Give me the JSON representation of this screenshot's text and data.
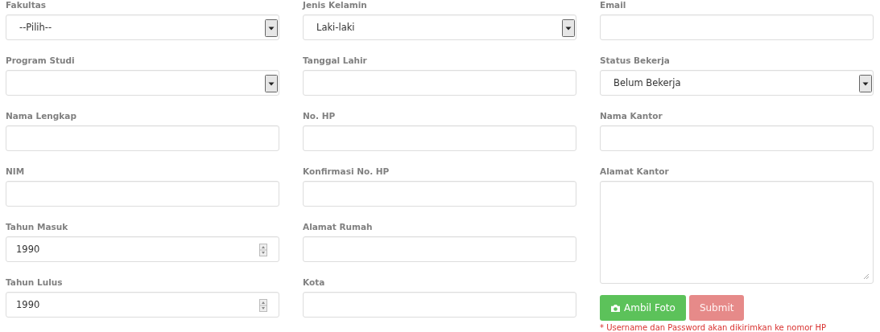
{
  "columns": [
    {
      "fields": [
        {
          "label": "Fakultas",
          "kind": "select",
          "value": "--Pilih--"
        },
        {
          "label": "Program Studi",
          "kind": "select"
        },
        {
          "label": "Nama Lengkap",
          "kind": "text"
        },
        {
          "label": "NIM",
          "kind": "text"
        },
        {
          "label": "Tahun Masuk",
          "kind": "number",
          "value": "1990"
        },
        {
          "label": "Tahun Lulus",
          "kind": "number",
          "value": "1990"
        }
      ]
    },
    {
      "fields": [
        {
          "label": "Jenis Kelamin",
          "kind": "select",
          "value": "Laki-laki"
        },
        {
          "label": "Tanggal Lahir",
          "kind": "text"
        },
        {
          "label": "No. HP",
          "kind": "text"
        },
        {
          "label": "Konfirmasi No. HP",
          "kind": "text"
        },
        {
          "label": "Alamat Rumah",
          "kind": "text"
        },
        {
          "label": "Kota",
          "kind": "text"
        }
      ]
    },
    {
      "fields": [
        {
          "label": "Email",
          "kind": "text"
        },
        {
          "label": "Status Bekerja",
          "kind": "select",
          "value": "Belum Bekerja"
        },
        {
          "label": "Nama Kantor",
          "kind": "text"
        },
        {
          "label": "Alamat Kantor",
          "kind": "textarea"
        }
      ]
    }
  ],
  "buttons": [
    {
      "label": "Ambil Foto",
      "kind": "photo",
      "disabled": false
    },
    {
      "label": "Submit",
      "kind": "submit",
      "disabled": true
    }
  ],
  "note": "* Username dan Password akan dikirimkan ke nomor HP"
}
